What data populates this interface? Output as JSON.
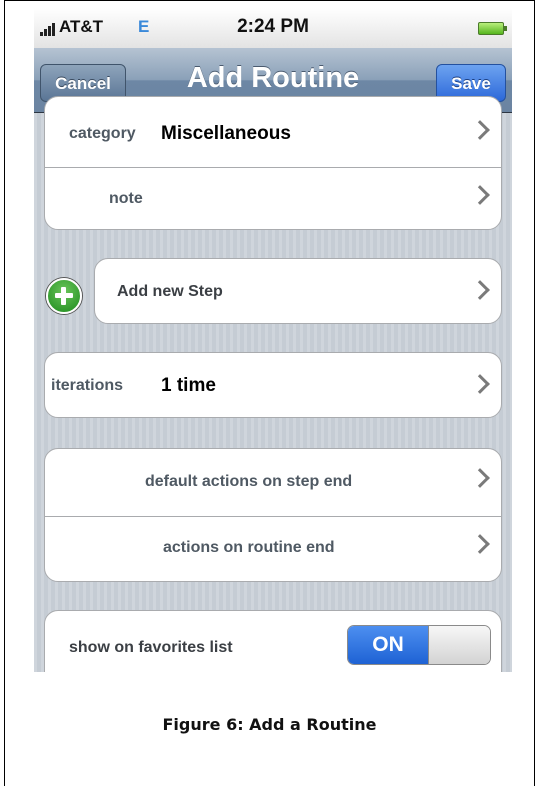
{
  "status_bar": {
    "carrier": "AT&T",
    "network": "E",
    "time": "2:24 PM"
  },
  "nav": {
    "title": "Add Routine",
    "cancel_label": "Cancel",
    "save_label": "Save"
  },
  "groups": {
    "details": [
      {
        "label": "category",
        "value": "Miscellaneous"
      },
      {
        "label": "note"
      }
    ],
    "steps": {
      "add_label": "Add new Step"
    },
    "iterations": {
      "label": "iterations",
      "value": "1 time"
    },
    "actions": [
      {
        "label": "default actions on step end"
      },
      {
        "label": "actions on routine end"
      }
    ],
    "favorites": {
      "label": "show on favorites list",
      "toggle_value": "ON"
    }
  },
  "caption": "Figure 6:  Add a Routine",
  "colors": {
    "save_button": "#2c68d9",
    "toggle_on": "#1e62d4",
    "add_step_icon": "#1d8a1d"
  }
}
